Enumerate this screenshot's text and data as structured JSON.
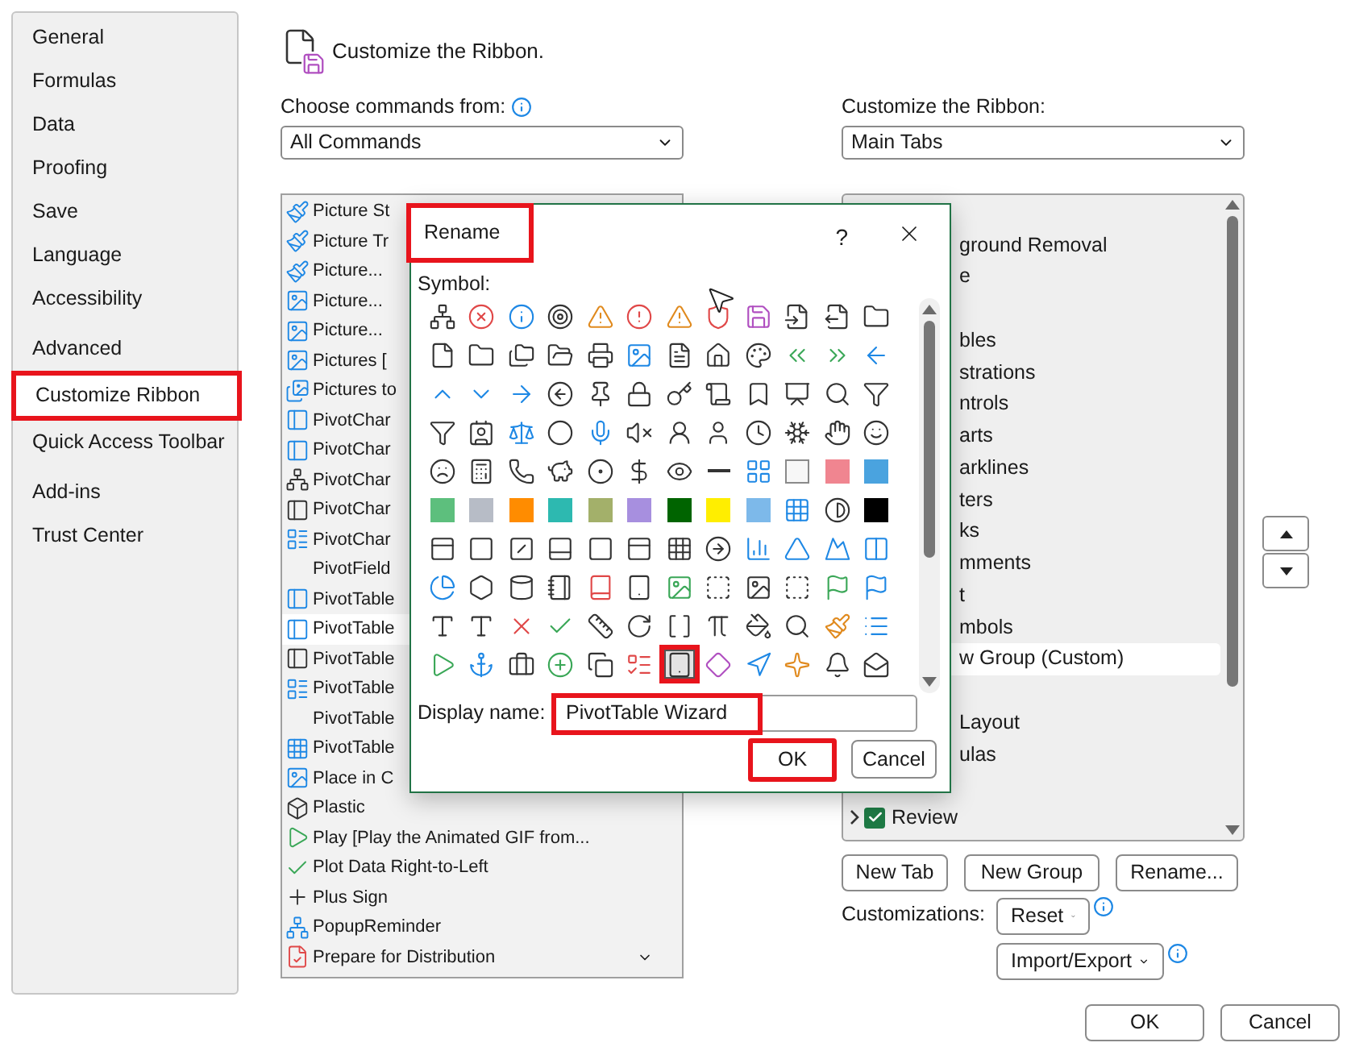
{
  "nav": {
    "groups": [
      {
        "items": [
          {
            "label": "General",
            "selected": false
          },
          {
            "label": "Formulas",
            "selected": false
          },
          {
            "label": "Data",
            "selected": false
          },
          {
            "label": "Proofing",
            "selected": false
          },
          {
            "label": "Save",
            "selected": false
          },
          {
            "label": "Language",
            "selected": false
          },
          {
            "label": "Accessibility",
            "selected": false
          }
        ]
      },
      {
        "items": [
          {
            "label": "Advanced",
            "selected": false
          },
          {
            "label": "Customize Ribbon",
            "selected": true
          },
          {
            "label": "Quick Access Toolbar",
            "selected": false
          }
        ]
      },
      {
        "items": [
          {
            "label": "Add-ins",
            "selected": false
          },
          {
            "label": "Trust Center",
            "selected": false
          }
        ]
      }
    ]
  },
  "header": {
    "title": "Customize the Ribbon."
  },
  "commands": {
    "label": "Choose commands from:",
    "value": "All Commands",
    "items": [
      {
        "text": "Picture St",
        "selected": false,
        "submenu": false
      },
      {
        "text": "Picture Tr",
        "selected": false,
        "submenu": false
      },
      {
        "text": "Picture...",
        "selected": false,
        "submenu": false
      },
      {
        "text": "Picture...",
        "selected": false,
        "submenu": false
      },
      {
        "text": "Picture...",
        "selected": false,
        "submenu": false
      },
      {
        "text": "Pictures [",
        "selected": false,
        "submenu": false
      },
      {
        "text": "Pictures to",
        "selected": false,
        "submenu": false
      },
      {
        "text": "PivotChar",
        "selected": false,
        "submenu": false
      },
      {
        "text": "PivotChar",
        "selected": false,
        "submenu": false
      },
      {
        "text": "PivotChar",
        "selected": false,
        "submenu": false
      },
      {
        "text": "PivotChar",
        "selected": false,
        "submenu": false
      },
      {
        "text": "PivotChar",
        "selected": false,
        "submenu": false
      },
      {
        "text": "PivotField",
        "selected": false,
        "submenu": false
      },
      {
        "text": "PivotTable",
        "selected": false,
        "submenu": false
      },
      {
        "text": "PivotTable",
        "selected": true,
        "submenu": false
      },
      {
        "text": "PivotTable",
        "selected": false,
        "submenu": false
      },
      {
        "text": "PivotTable",
        "selected": false,
        "submenu": false
      },
      {
        "text": "PivotTable",
        "selected": false,
        "submenu": false
      },
      {
        "text": "PivotTable",
        "selected": false,
        "submenu": false
      },
      {
        "text": "Place in C",
        "selected": false,
        "submenu": false
      },
      {
        "text": "Plastic",
        "selected": false,
        "submenu": false
      },
      {
        "text": "Play [Play the Animated GIF from...",
        "selected": false,
        "submenu": false
      },
      {
        "text": "Plot Data Right-to-Left",
        "selected": false,
        "submenu": false
      },
      {
        "text": "Plus Sign",
        "selected": false,
        "submenu": false
      },
      {
        "text": "PopupReminder",
        "selected": false,
        "submenu": false
      },
      {
        "text": "Prepare for Distribution",
        "selected": false,
        "submenu": true
      }
    ]
  },
  "ribbon": {
    "label": "Customize the Ribbon:",
    "value": "Main Tabs",
    "items": [
      {
        "kind": "covered"
      },
      {
        "kind": "group",
        "text": "ground Removal",
        "selected": false
      },
      {
        "kind": "group",
        "text": "e",
        "selected": false
      },
      {
        "kind": "covered"
      },
      {
        "kind": "group",
        "text": "bles",
        "selected": false
      },
      {
        "kind": "group",
        "text": "strations",
        "selected": false
      },
      {
        "kind": "group",
        "text": "ntrols",
        "selected": false
      },
      {
        "kind": "group",
        "text": "arts",
        "selected": false
      },
      {
        "kind": "group",
        "text": "arklines",
        "selected": false
      },
      {
        "kind": "group",
        "text": "ters",
        "selected": false
      },
      {
        "kind": "group",
        "text": "ks",
        "selected": false
      },
      {
        "kind": "group",
        "text": "mments",
        "selected": false
      },
      {
        "kind": "group",
        "text": "t",
        "selected": false
      },
      {
        "kind": "group",
        "text": "mbols",
        "selected": false
      },
      {
        "kind": "group",
        "text": "w Group (Custom)",
        "selected": true
      },
      {
        "kind": "covered"
      },
      {
        "kind": "group",
        "text": "Layout",
        "selected": false
      },
      {
        "kind": "group",
        "text": "ulas",
        "selected": false
      },
      {
        "kind": "covered"
      },
      {
        "kind": "tab",
        "text": "Review",
        "checked": true,
        "expanded": false
      }
    ]
  },
  "ribbon_buttons": [
    "New Tab",
    "New Group",
    "Rename..."
  ],
  "customizations": {
    "label": "Customizations:",
    "reset": "Reset",
    "import_export": "Import/Export"
  },
  "footer": {
    "ok": "OK",
    "cancel": "Cancel"
  },
  "rename_dialog": {
    "title": "Rename",
    "title_highlighted": true,
    "help": "?",
    "symbol_label": "Symbol:",
    "display_name_label": "Display name:",
    "display_name": "PivotTable Wizard",
    "display_name_highlighted": true,
    "ok": "OK",
    "ok_highlighted": true,
    "cancel": "Cancel",
    "symbols": [
      {
        "kind": "icon",
        "selected": false
      },
      {
        "kind": "icon",
        "selected": false
      },
      {
        "kind": "icon",
        "selected": false
      },
      {
        "kind": "icon",
        "selected": false
      },
      {
        "kind": "icon",
        "selected": false
      },
      {
        "kind": "icon",
        "selected": false
      },
      {
        "kind": "icon",
        "selected": false
      },
      {
        "kind": "icon",
        "selected": false
      },
      {
        "kind": "icon",
        "selected": false
      },
      {
        "kind": "icon",
        "selected": false
      },
      {
        "kind": "icon",
        "selected": false
      },
      {
        "kind": "icon",
        "selected": false
      },
      {
        "kind": "icon",
        "selected": false
      },
      {
        "kind": "icon",
        "selected": false
      },
      {
        "kind": "icon",
        "selected": false
      },
      {
        "kind": "icon",
        "selected": false
      },
      {
        "kind": "icon",
        "selected": false
      },
      {
        "kind": "icon",
        "selected": false
      },
      {
        "kind": "icon",
        "selected": false
      },
      {
        "kind": "icon",
        "selected": false
      },
      {
        "kind": "icon",
        "selected": false
      },
      {
        "kind": "icon",
        "selected": false
      },
      {
        "kind": "icon",
        "selected": false
      },
      {
        "kind": "icon",
        "selected": false
      },
      {
        "kind": "icon",
        "selected": false
      },
      {
        "kind": "icon",
        "selected": false
      },
      {
        "kind": "icon",
        "selected": false
      },
      {
        "kind": "icon",
        "selected": false
      },
      {
        "kind": "icon",
        "selected": false
      },
      {
        "kind": "icon",
        "selected": false
      },
      {
        "kind": "icon",
        "selected": false
      },
      {
        "kind": "icon",
        "selected": false
      },
      {
        "kind": "icon",
        "selected": false
      },
      {
        "kind": "icon",
        "selected": false
      },
      {
        "kind": "icon",
        "selected": false
      },
      {
        "kind": "icon",
        "selected": false
      },
      {
        "kind": "icon",
        "selected": false
      },
      {
        "kind": "icon",
        "selected": false
      },
      {
        "kind": "icon",
        "selected": false
      },
      {
        "kind": "icon",
        "selected": false
      },
      {
        "kind": "icon",
        "selected": false
      },
      {
        "kind": "icon",
        "selected": false
      },
      {
        "kind": "icon",
        "selected": false
      },
      {
        "kind": "icon",
        "selected": false
      },
      {
        "kind": "icon",
        "selected": false
      },
      {
        "kind": "icon",
        "selected": false
      },
      {
        "kind": "icon",
        "selected": false
      },
      {
        "kind": "icon",
        "selected": false
      },
      {
        "kind": "icon",
        "selected": false
      },
      {
        "kind": "icon",
        "selected": false
      },
      {
        "kind": "icon",
        "selected": false
      },
      {
        "kind": "icon",
        "selected": false
      },
      {
        "kind": "icon",
        "selected": false
      },
      {
        "kind": "icon",
        "selected": false
      },
      {
        "kind": "icon",
        "selected": false
      },
      {
        "kind": "icon",
        "selected": false
      },
      {
        "kind": "icon",
        "selected": false
      },
      {
        "kind": "swatch",
        "color": "#f7f7f7",
        "selected": false
      },
      {
        "kind": "swatch",
        "color": "#f08590",
        "selected": false
      },
      {
        "kind": "swatch",
        "color": "#4aa3df",
        "selected": false
      },
      {
        "kind": "swatch",
        "color": "#5dbf7d",
        "selected": false
      },
      {
        "kind": "swatch",
        "color": "#b7bcc6",
        "selected": false
      },
      {
        "kind": "swatch",
        "color": "#ff8c00",
        "selected": false
      },
      {
        "kind": "swatch",
        "color": "#2db9b0",
        "selected": false
      },
      {
        "kind": "swatch",
        "color": "#a3b06a",
        "selected": false
      },
      {
        "kind": "swatch",
        "color": "#a78fdf",
        "selected": false
      },
      {
        "kind": "swatch",
        "color": "#006400",
        "selected": false
      },
      {
        "kind": "swatch",
        "color": "#ffee00",
        "selected": false
      },
      {
        "kind": "swatch",
        "color": "#7db9ea",
        "selected": false
      },
      {
        "kind": "icon",
        "selected": false
      },
      {
        "kind": "icon",
        "selected": false
      },
      {
        "kind": "swatch",
        "color": "#000000",
        "selected": false
      },
      {
        "kind": "icon",
        "selected": false
      },
      {
        "kind": "icon",
        "selected": false
      },
      {
        "kind": "icon",
        "selected": false
      },
      {
        "kind": "icon",
        "selected": false
      },
      {
        "kind": "icon",
        "selected": false
      },
      {
        "kind": "icon",
        "selected": false
      },
      {
        "kind": "icon",
        "selected": false
      },
      {
        "kind": "icon",
        "selected": false
      },
      {
        "kind": "icon",
        "selected": false
      },
      {
        "kind": "icon",
        "selected": false
      },
      {
        "kind": "icon",
        "selected": false
      },
      {
        "kind": "icon",
        "selected": false
      },
      {
        "kind": "icon",
        "selected": false
      },
      {
        "kind": "icon",
        "selected": false
      },
      {
        "kind": "icon",
        "selected": false
      },
      {
        "kind": "icon",
        "selected": false
      },
      {
        "kind": "icon",
        "selected": false
      },
      {
        "kind": "icon",
        "selected": false
      },
      {
        "kind": "icon",
        "selected": false
      },
      {
        "kind": "icon",
        "selected": false
      },
      {
        "kind": "icon",
        "selected": false
      },
      {
        "kind": "icon",
        "selected": false
      },
      {
        "kind": "icon",
        "selected": false
      },
      {
        "kind": "icon",
        "selected": false
      },
      {
        "kind": "icon",
        "selected": false
      },
      {
        "kind": "icon",
        "selected": false
      },
      {
        "kind": "icon",
        "selected": false
      },
      {
        "kind": "icon",
        "selected": false
      },
      {
        "kind": "icon",
        "selected": false
      },
      {
        "kind": "icon",
        "selected": false
      },
      {
        "kind": "icon",
        "selected": false
      },
      {
        "kind": "icon",
        "selected": false
      },
      {
        "kind": "icon",
        "selected": false
      },
      {
        "kind": "icon",
        "selected": false
      },
      {
        "kind": "icon",
        "selected": false
      },
      {
        "kind": "icon",
        "selected": false
      },
      {
        "kind": "icon",
        "selected": false
      },
      {
        "kind": "icon",
        "selected": false
      },
      {
        "kind": "icon",
        "selected": false
      },
      {
        "kind": "icon",
        "selected": false
      },
      {
        "kind": "icon",
        "selected": false
      },
      {
        "kind": "icon",
        "selected": false
      },
      {
        "kind": "icon",
        "selected": true
      },
      {
        "kind": "icon",
        "selected": false
      },
      {
        "kind": "icon",
        "selected": false
      },
      {
        "kind": "icon",
        "selected": false
      },
      {
        "kind": "icon",
        "selected": false
      },
      {
        "kind": "icon",
        "selected": false
      }
    ]
  }
}
